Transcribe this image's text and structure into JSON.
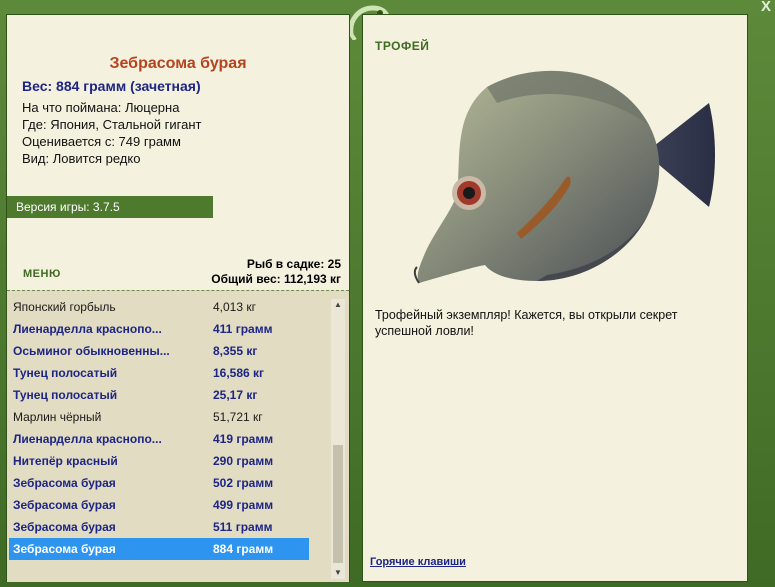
{
  "window": {
    "close_label": "X"
  },
  "fish": {
    "title": "Зебрасома бурая",
    "weight_line": "Вес: 884 грамм (зачетная)",
    "bait": "На что поймана: Люцерна",
    "location": "Где: Япония, Стальной гигант",
    "valued": "Оценивается с: 749 грамм",
    "kind": "Вид: Ловится редко"
  },
  "version": "Версия игры: 3.7.5",
  "menu_label": "МЕНЮ",
  "keep": {
    "count_line": "Рыб в садке: 25",
    "weight_line": "Общий вес: 112,193 кг"
  },
  "catch_list": [
    {
      "name": "Японский горбыль",
      "weight": "4,013 кг",
      "trophy": false
    },
    {
      "name": "Лиенарделла краснопо...",
      "weight": "411 грамм",
      "trophy": true
    },
    {
      "name": "Осьминог обыкновенны...",
      "weight": "8,355 кг",
      "trophy": true
    },
    {
      "name": "Тунец полосатый",
      "weight": "16,586 кг",
      "trophy": true
    },
    {
      "name": "Тунец полосатый",
      "weight": "25,17 кг",
      "trophy": true
    },
    {
      "name": "Марлин чёрный",
      "weight": "51,721 кг",
      "trophy": false
    },
    {
      "name": "Лиенарделла краснопо...",
      "weight": "419 грамм",
      "trophy": true
    },
    {
      "name": "Нитепёр красный",
      "weight": "290 грамм",
      "trophy": true
    },
    {
      "name": "Зебрасома бурая",
      "weight": "502 грамм",
      "trophy": true
    },
    {
      "name": "Зебрасома бурая",
      "weight": "499 грамм",
      "trophy": true
    },
    {
      "name": "Зебрасома бурая",
      "weight": "511 грамм",
      "trophy": true
    },
    {
      "name": "Зебрасома бурая",
      "weight": "884 грамм",
      "trophy": true,
      "selected": true
    }
  ],
  "trophy": {
    "label": "ТРОФЕЙ",
    "text": "Трофейный экземпляр! Кажется, вы открыли секрет успешной ловли!",
    "image_icon": "zebrasoma-fish-image"
  },
  "hotkeys_label": "Горячие клавиши",
  "colors": {
    "frame": "#4f7a31",
    "panel": "#f4f1de",
    "title": "#b5431e",
    "trophy_text": "#1d2585",
    "selection": "#2d95f0"
  }
}
